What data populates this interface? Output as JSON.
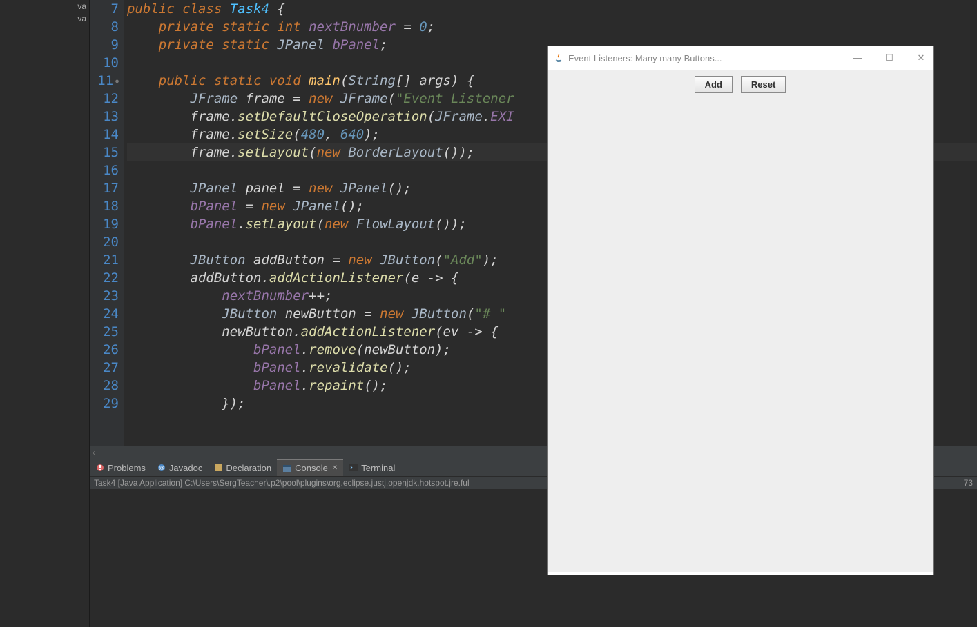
{
  "sidebar": {
    "items": [
      "va",
      "va"
    ]
  },
  "gutter": {
    "lines": [
      {
        "n": "7",
        "cls": "blue"
      },
      {
        "n": "8",
        "cls": "blue"
      },
      {
        "n": "9",
        "cls": "blue"
      },
      {
        "n": "10",
        "cls": "blue"
      },
      {
        "n": "11",
        "cls": "blue anno"
      },
      {
        "n": "12",
        "cls": "blue"
      },
      {
        "n": "13",
        "cls": "blue"
      },
      {
        "n": "14",
        "cls": "blue"
      },
      {
        "n": "15",
        "cls": "blue"
      },
      {
        "n": "16",
        "cls": "blue"
      },
      {
        "n": "17",
        "cls": "blue"
      },
      {
        "n": "18",
        "cls": "blue"
      },
      {
        "n": "19",
        "cls": "blue"
      },
      {
        "n": "20",
        "cls": "blue"
      },
      {
        "n": "21",
        "cls": "blue"
      },
      {
        "n": "22",
        "cls": "blue"
      },
      {
        "n": "23",
        "cls": "blue"
      },
      {
        "n": "24",
        "cls": "blue"
      },
      {
        "n": "25",
        "cls": "blue"
      },
      {
        "n": "26",
        "cls": "blue"
      },
      {
        "n": "27",
        "cls": "blue"
      },
      {
        "n": "28",
        "cls": "blue"
      },
      {
        "n": "29",
        "cls": "blue"
      }
    ]
  },
  "code": {
    "lines": [
      {
        "t": [
          {
            "c": "kw",
            "s": "public class "
          },
          {
            "c": "cls",
            "s": "Task4"
          },
          {
            "c": "id",
            "s": " {"
          }
        ]
      },
      {
        "t": [
          {
            "c": "id",
            "s": "    "
          },
          {
            "c": "kw",
            "s": "private static int "
          },
          {
            "c": "ital",
            "s": "nextBnumber"
          },
          {
            "c": "id",
            "s": " = "
          },
          {
            "c": "num",
            "s": "0"
          },
          {
            "c": "id",
            "s": ";"
          }
        ]
      },
      {
        "t": [
          {
            "c": "id",
            "s": "    "
          },
          {
            "c": "kw",
            "s": "private static "
          },
          {
            "c": "type3",
            "s": "JPanel "
          },
          {
            "c": "ital",
            "s": "bPanel"
          },
          {
            "c": "id",
            "s": ";"
          }
        ]
      },
      {
        "t": [
          {
            "c": "id",
            "s": ""
          }
        ]
      },
      {
        "t": [
          {
            "c": "id",
            "s": "    "
          },
          {
            "c": "kw",
            "s": "public static void "
          },
          {
            "c": "fn",
            "s": "main"
          },
          {
            "c": "id",
            "s": "("
          },
          {
            "c": "type3",
            "s": "String"
          },
          {
            "c": "id",
            "s": "[] "
          },
          {
            "c": "id",
            "s": "args"
          },
          {
            "c": "id",
            "s": ") {"
          }
        ]
      },
      {
        "t": [
          {
            "c": "id",
            "s": "        "
          },
          {
            "c": "type3",
            "s": "JFrame "
          },
          {
            "c": "id",
            "s": "frame"
          },
          {
            "c": "id",
            "s": " = "
          },
          {
            "c": "kw",
            "s": "new "
          },
          {
            "c": "type3",
            "s": "JFrame"
          },
          {
            "c": "id",
            "s": "("
          },
          {
            "c": "str",
            "s": "\"Event Listener"
          }
        ]
      },
      {
        "t": [
          {
            "c": "id",
            "s": "        frame."
          },
          {
            "c": "mname",
            "s": "setDefaultCloseOperation"
          },
          {
            "c": "id",
            "s": "("
          },
          {
            "c": "type3",
            "s": "JFrame"
          },
          {
            "c": "id",
            "s": "."
          },
          {
            "c": "ital",
            "s": "EXI"
          }
        ]
      },
      {
        "t": [
          {
            "c": "id",
            "s": "        frame."
          },
          {
            "c": "mname",
            "s": "setSize"
          },
          {
            "c": "id",
            "s": "("
          },
          {
            "c": "num",
            "s": "480"
          },
          {
            "c": "id",
            "s": ", "
          },
          {
            "c": "num",
            "s": "640"
          },
          {
            "c": "id",
            "s": ");"
          }
        ]
      },
      {
        "hl": true,
        "t": [
          {
            "c": "id",
            "s": "        frame."
          },
          {
            "c": "mname",
            "s": "setLayout"
          },
          {
            "c": "id",
            "s": "("
          },
          {
            "c": "kw",
            "s": "new "
          },
          {
            "c": "type3",
            "s": "BorderLayout"
          },
          {
            "c": "id",
            "s": "());"
          }
        ]
      },
      {
        "t": [
          {
            "c": "id",
            "s": ""
          }
        ]
      },
      {
        "t": [
          {
            "c": "id",
            "s": "        "
          },
          {
            "c": "type3",
            "s": "JPanel "
          },
          {
            "c": "id",
            "s": "panel"
          },
          {
            "c": "id",
            "s": " = "
          },
          {
            "c": "kw",
            "s": "new "
          },
          {
            "c": "type3",
            "s": "JPanel"
          },
          {
            "c": "id",
            "s": "();"
          }
        ]
      },
      {
        "t": [
          {
            "c": "id",
            "s": "        "
          },
          {
            "c": "ital",
            "s": "bPanel"
          },
          {
            "c": "id",
            "s": " = "
          },
          {
            "c": "kw",
            "s": "new "
          },
          {
            "c": "type3",
            "s": "JPanel"
          },
          {
            "c": "id",
            "s": "();"
          }
        ]
      },
      {
        "t": [
          {
            "c": "id",
            "s": "        "
          },
          {
            "c": "ital",
            "s": "bPanel"
          },
          {
            "c": "id",
            "s": "."
          },
          {
            "c": "mname",
            "s": "setLayout"
          },
          {
            "c": "id",
            "s": "("
          },
          {
            "c": "kw",
            "s": "new "
          },
          {
            "c": "type3",
            "s": "FlowLayout"
          },
          {
            "c": "id",
            "s": "());"
          }
        ]
      },
      {
        "t": [
          {
            "c": "id",
            "s": ""
          }
        ]
      },
      {
        "t": [
          {
            "c": "id",
            "s": "        "
          },
          {
            "c": "type3",
            "s": "JButton "
          },
          {
            "c": "id",
            "s": "addButton"
          },
          {
            "c": "id",
            "s": " = "
          },
          {
            "c": "kw",
            "s": "new "
          },
          {
            "c": "type3",
            "s": "JButton"
          },
          {
            "c": "id",
            "s": "("
          },
          {
            "c": "str",
            "s": "\"Add\""
          },
          {
            "c": "id",
            "s": ");"
          }
        ]
      },
      {
        "t": [
          {
            "c": "id",
            "s": "        addButton."
          },
          {
            "c": "mname",
            "s": "addActionListener"
          },
          {
            "c": "id",
            "s": "(e -> {"
          }
        ]
      },
      {
        "t": [
          {
            "c": "id",
            "s": "            "
          },
          {
            "c": "ital",
            "s": "nextBnumber"
          },
          {
            "c": "id",
            "s": "++;"
          }
        ]
      },
      {
        "t": [
          {
            "c": "id",
            "s": "            "
          },
          {
            "c": "type3",
            "s": "JButton "
          },
          {
            "c": "id",
            "s": "newButton"
          },
          {
            "c": "id",
            "s": " = "
          },
          {
            "c": "kw",
            "s": "new "
          },
          {
            "c": "type3",
            "s": "JButton"
          },
          {
            "c": "id",
            "s": "("
          },
          {
            "c": "str",
            "s": "\"# \""
          }
        ]
      },
      {
        "t": [
          {
            "c": "id",
            "s": "            newButton."
          },
          {
            "c": "mname",
            "s": "addActionListener"
          },
          {
            "c": "id",
            "s": "(ev -> {"
          }
        ]
      },
      {
        "t": [
          {
            "c": "id",
            "s": "                "
          },
          {
            "c": "ital",
            "s": "bPanel"
          },
          {
            "c": "id",
            "s": "."
          },
          {
            "c": "mname",
            "s": "remove"
          },
          {
            "c": "id",
            "s": "(newButton);"
          }
        ]
      },
      {
        "t": [
          {
            "c": "id",
            "s": "                "
          },
          {
            "c": "ital",
            "s": "bPanel"
          },
          {
            "c": "id",
            "s": "."
          },
          {
            "c": "mname",
            "s": "revalidate"
          },
          {
            "c": "id",
            "s": "();"
          }
        ]
      },
      {
        "t": [
          {
            "c": "id",
            "s": "                "
          },
          {
            "c": "ital",
            "s": "bPanel"
          },
          {
            "c": "id",
            "s": "."
          },
          {
            "c": "mname",
            "s": "repaint"
          },
          {
            "c": "id",
            "s": "();"
          }
        ]
      },
      {
        "t": [
          {
            "c": "id",
            "s": "            });"
          }
        ]
      }
    ]
  },
  "cursor_position": "|",
  "tabs": {
    "problems": "Problems",
    "javadoc": "Javadoc",
    "declaration": "Declaration",
    "console": "Console",
    "terminal": "Terminal"
  },
  "console": {
    "info": "Task4 [Java Application] C:\\Users\\SergTeacher\\.p2\\pool\\plugins\\org.eclipse.justj.openjdk.hotspot.jre.ful",
    "right": "73"
  },
  "swing": {
    "title": "Event Listeners: Many many Buttons...",
    "buttons": {
      "add": "Add",
      "reset": "Reset"
    }
  }
}
